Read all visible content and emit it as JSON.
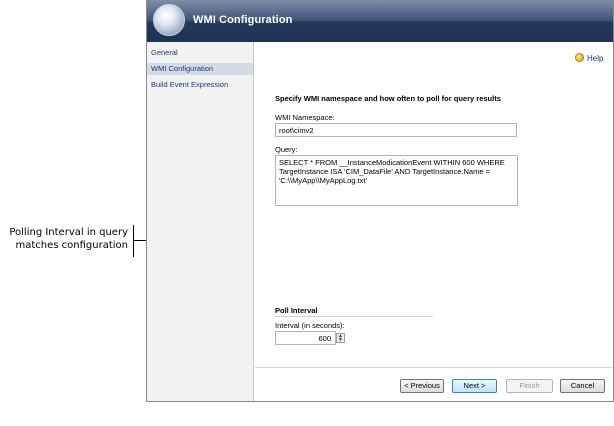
{
  "callout": {
    "line1": "Polling Interval in query",
    "line2": "matches configuration"
  },
  "dialog": {
    "title": "WMI Configuration",
    "help_label": "Help",
    "nav": [
      {
        "label": "General",
        "selected": false
      },
      {
        "label": "WMI Configuration",
        "selected": true
      },
      {
        "label": "Build Event Expression",
        "selected": false
      }
    ],
    "section_title": "Specify WMI namespace and how often to poll for query results",
    "namespace": {
      "label": "WMI Namespace:",
      "value": "root\\cimv2"
    },
    "query": {
      "label": "Query:",
      "value": "SELECT * FROM __InstanceModicationEvent WITHIN 600 WHERE TargetInstance ISA 'CIM_DataFile' AND TargetInstance.Name = 'C:\\\\MyApp\\\\MyAppLog.txt'"
    },
    "poll": {
      "section_title": "Poll Interval",
      "label": "Interval (in seconds):",
      "value": "600"
    },
    "buttons": {
      "previous": "< Previous",
      "next": "Next >",
      "finish": "Finish",
      "cancel": "Cancel"
    }
  }
}
